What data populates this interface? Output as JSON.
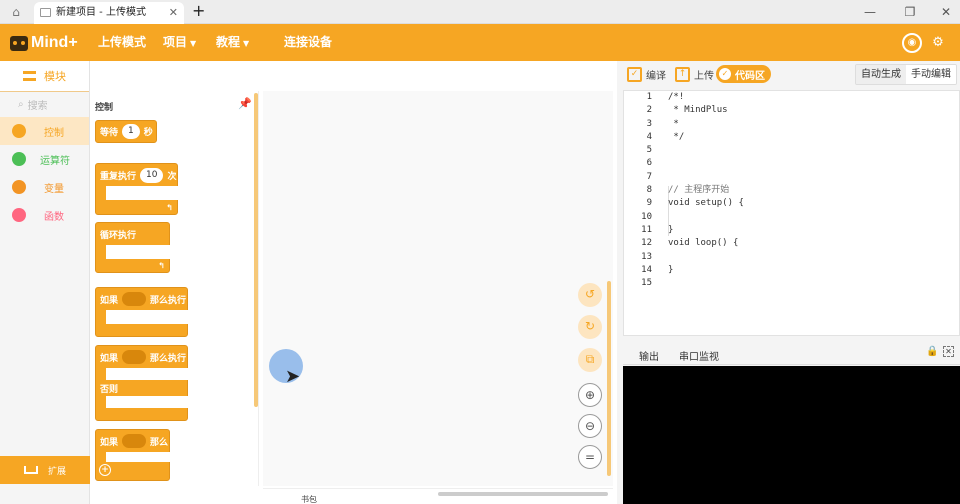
{
  "titlebar": {
    "tab_label": "新建项目 - 上传模式",
    "tab_close": "✕",
    "new_tab": "+",
    "window_controls": [
      "—",
      "❐",
      "✕"
    ]
  },
  "menubar": {
    "logo": "Mind+",
    "items": [
      {
        "label": "上传模式",
        "caret": ""
      },
      {
        "label": "项目",
        "caret": "▼"
      },
      {
        "label": "教程",
        "caret": "▼"
      },
      {
        "label": "连接设备",
        "caret": ""
      }
    ],
    "icons": [
      "robot-icon",
      "gear-icon"
    ]
  },
  "sidebar": {
    "tab_label": "模块",
    "search_placeholder": "搜索",
    "categories": [
      {
        "label": "控制",
        "color": "#f6a623",
        "text_color": "#f6a623",
        "selected": true
      },
      {
        "label": "运算符",
        "color": "#4cbf56",
        "text_color": "#4cbf56",
        "selected": false
      },
      {
        "label": "变量",
        "color": "#f29424",
        "text_color": "#f29424",
        "selected": false
      },
      {
        "label": "函数",
        "color": "#ff6680",
        "text_color": "#ff6680",
        "selected": false
      }
    ],
    "extension_label": "扩展"
  },
  "palette": {
    "title": "控制",
    "blocks": {
      "wait": {
        "pre": "等待",
        "value": "1",
        "post": "秒"
      },
      "repeat": {
        "pre": "重复执行",
        "value": "10",
        "post": "次"
      },
      "forever": {
        "label": "循环执行"
      },
      "if_then": {
        "pre": "如果",
        "post": "那么执行"
      },
      "if_else": {
        "pre": "如果",
        "post": "那么执行",
        "else": "否则"
      },
      "if_plain": {
        "pre": "如果",
        "post": "那么"
      }
    }
  },
  "workspace": {
    "controls": [
      "undo-icon",
      "redo-icon",
      "cleanup-icon",
      "zoom-in-icon",
      "zoom-out-icon",
      "zoom-reset-icon"
    ],
    "zoom_glyphs": [
      "↺",
      "↻",
      "⧉",
      "⊕",
      "⊖",
      "="
    ],
    "bottom_label": "书包"
  },
  "code_panel": {
    "compile_label": "编译",
    "upload_label": "上传",
    "code_label": "代码区",
    "mode_auto": "自动生成",
    "mode_manual": "手动编辑",
    "lines": [
      {
        "n": "1",
        "text": "/*!",
        "comment": false
      },
      {
        "n": "2",
        "text": " * MindPlus",
        "comment": false
      },
      {
        "n": "3",
        "text": " *",
        "comment": false
      },
      {
        "n": "4",
        "text": " */",
        "comment": false
      },
      {
        "n": "5",
        "text": "",
        "comment": false
      },
      {
        "n": "6",
        "text": "",
        "comment": false
      },
      {
        "n": "7",
        "text": "",
        "comment": false
      },
      {
        "n": "8",
        "text": "// 主程序开始",
        "comment": true
      },
      {
        "n": "9",
        "text": "void setup() {",
        "comment": false
      },
      {
        "n": "10",
        "text": "",
        "comment": false
      },
      {
        "n": "11",
        "text": "}",
        "comment": false
      },
      {
        "n": "12",
        "text": "void loop() {",
        "comment": false
      },
      {
        "n": "13",
        "text": "",
        "comment": false
      },
      {
        "n": "14",
        "text": "}",
        "comment": false
      },
      {
        "n": "15",
        "text": "",
        "comment": false
      }
    ]
  },
  "output_panel": {
    "tab_output": "输出",
    "tab_serial": "串口监视"
  }
}
